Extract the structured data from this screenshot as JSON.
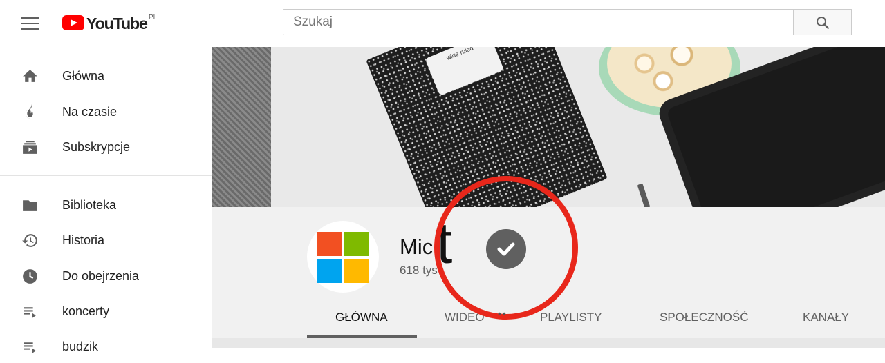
{
  "header": {
    "logo_text": "YouTube",
    "country_code": "PL",
    "search": {
      "placeholder": "Szukaj",
      "value": ""
    }
  },
  "sidebar": {
    "items": [
      {
        "label": "Główna",
        "icon": "home-icon"
      },
      {
        "label": "Na czasie",
        "icon": "trending-icon"
      },
      {
        "label": "Subskrypcje",
        "icon": "subscriptions-icon"
      },
      {
        "label": "Biblioteka",
        "icon": "library-icon"
      },
      {
        "label": "Historia",
        "icon": "history-icon"
      },
      {
        "label": "Do obejrzenia",
        "icon": "watch-later-icon"
      },
      {
        "label": "koncerty",
        "icon": "playlist-icon"
      },
      {
        "label": "budzik",
        "icon": "playlist-icon"
      }
    ]
  },
  "channel": {
    "name": "Mic",
    "big_letter": "t",
    "subscribers": "618 tys",
    "verified_icon": "verified-check-icon",
    "tabs": [
      "GŁÓWNA",
      "WIDEO",
      "PLAYLISTY",
      "SPOŁECZNOŚĆ",
      "KANAŁY"
    ],
    "active_tab": "GŁÓWNA",
    "dots": "••"
  },
  "banner": {
    "label_text": "wide ruled"
  },
  "colors": {
    "brand_red": "#ff0000",
    "annotation_red": "#e8271b",
    "ms_red": "#f25022",
    "ms_green": "#7fba00",
    "ms_blue": "#00a4ef",
    "ms_yellow": "#ffb900"
  }
}
